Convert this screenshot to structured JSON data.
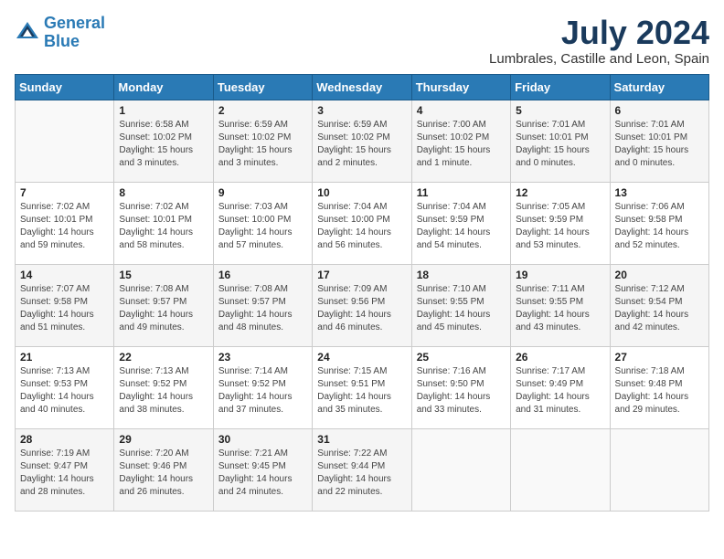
{
  "header": {
    "logo_line1": "General",
    "logo_line2": "Blue",
    "month_year": "July 2024",
    "location": "Lumbrales, Castille and Leon, Spain"
  },
  "weekdays": [
    "Sunday",
    "Monday",
    "Tuesday",
    "Wednesday",
    "Thursday",
    "Friday",
    "Saturday"
  ],
  "weeks": [
    [
      {
        "day": "",
        "content": ""
      },
      {
        "day": "1",
        "content": "Sunrise: 6:58 AM\nSunset: 10:02 PM\nDaylight: 15 hours\nand 3 minutes."
      },
      {
        "day": "2",
        "content": "Sunrise: 6:59 AM\nSunset: 10:02 PM\nDaylight: 15 hours\nand 3 minutes."
      },
      {
        "day": "3",
        "content": "Sunrise: 6:59 AM\nSunset: 10:02 PM\nDaylight: 15 hours\nand 2 minutes."
      },
      {
        "day": "4",
        "content": "Sunrise: 7:00 AM\nSunset: 10:02 PM\nDaylight: 15 hours\nand 1 minute."
      },
      {
        "day": "5",
        "content": "Sunrise: 7:01 AM\nSunset: 10:01 PM\nDaylight: 15 hours\nand 0 minutes."
      },
      {
        "day": "6",
        "content": "Sunrise: 7:01 AM\nSunset: 10:01 PM\nDaylight: 15 hours\nand 0 minutes."
      }
    ],
    [
      {
        "day": "7",
        "content": "Sunrise: 7:02 AM\nSunset: 10:01 PM\nDaylight: 14 hours\nand 59 minutes."
      },
      {
        "day": "8",
        "content": "Sunrise: 7:02 AM\nSunset: 10:01 PM\nDaylight: 14 hours\nand 58 minutes."
      },
      {
        "day": "9",
        "content": "Sunrise: 7:03 AM\nSunset: 10:00 PM\nDaylight: 14 hours\nand 57 minutes."
      },
      {
        "day": "10",
        "content": "Sunrise: 7:04 AM\nSunset: 10:00 PM\nDaylight: 14 hours\nand 56 minutes."
      },
      {
        "day": "11",
        "content": "Sunrise: 7:04 AM\nSunset: 9:59 PM\nDaylight: 14 hours\nand 54 minutes."
      },
      {
        "day": "12",
        "content": "Sunrise: 7:05 AM\nSunset: 9:59 PM\nDaylight: 14 hours\nand 53 minutes."
      },
      {
        "day": "13",
        "content": "Sunrise: 7:06 AM\nSunset: 9:58 PM\nDaylight: 14 hours\nand 52 minutes."
      }
    ],
    [
      {
        "day": "14",
        "content": "Sunrise: 7:07 AM\nSunset: 9:58 PM\nDaylight: 14 hours\nand 51 minutes."
      },
      {
        "day": "15",
        "content": "Sunrise: 7:08 AM\nSunset: 9:57 PM\nDaylight: 14 hours\nand 49 minutes."
      },
      {
        "day": "16",
        "content": "Sunrise: 7:08 AM\nSunset: 9:57 PM\nDaylight: 14 hours\nand 48 minutes."
      },
      {
        "day": "17",
        "content": "Sunrise: 7:09 AM\nSunset: 9:56 PM\nDaylight: 14 hours\nand 46 minutes."
      },
      {
        "day": "18",
        "content": "Sunrise: 7:10 AM\nSunset: 9:55 PM\nDaylight: 14 hours\nand 45 minutes."
      },
      {
        "day": "19",
        "content": "Sunrise: 7:11 AM\nSunset: 9:55 PM\nDaylight: 14 hours\nand 43 minutes."
      },
      {
        "day": "20",
        "content": "Sunrise: 7:12 AM\nSunset: 9:54 PM\nDaylight: 14 hours\nand 42 minutes."
      }
    ],
    [
      {
        "day": "21",
        "content": "Sunrise: 7:13 AM\nSunset: 9:53 PM\nDaylight: 14 hours\nand 40 minutes."
      },
      {
        "day": "22",
        "content": "Sunrise: 7:13 AM\nSunset: 9:52 PM\nDaylight: 14 hours\nand 38 minutes."
      },
      {
        "day": "23",
        "content": "Sunrise: 7:14 AM\nSunset: 9:52 PM\nDaylight: 14 hours\nand 37 minutes."
      },
      {
        "day": "24",
        "content": "Sunrise: 7:15 AM\nSunset: 9:51 PM\nDaylight: 14 hours\nand 35 minutes."
      },
      {
        "day": "25",
        "content": "Sunrise: 7:16 AM\nSunset: 9:50 PM\nDaylight: 14 hours\nand 33 minutes."
      },
      {
        "day": "26",
        "content": "Sunrise: 7:17 AM\nSunset: 9:49 PM\nDaylight: 14 hours\nand 31 minutes."
      },
      {
        "day": "27",
        "content": "Sunrise: 7:18 AM\nSunset: 9:48 PM\nDaylight: 14 hours\nand 29 minutes."
      }
    ],
    [
      {
        "day": "28",
        "content": "Sunrise: 7:19 AM\nSunset: 9:47 PM\nDaylight: 14 hours\nand 28 minutes."
      },
      {
        "day": "29",
        "content": "Sunrise: 7:20 AM\nSunset: 9:46 PM\nDaylight: 14 hours\nand 26 minutes."
      },
      {
        "day": "30",
        "content": "Sunrise: 7:21 AM\nSunset: 9:45 PM\nDaylight: 14 hours\nand 24 minutes."
      },
      {
        "day": "31",
        "content": "Sunrise: 7:22 AM\nSunset: 9:44 PM\nDaylight: 14 hours\nand 22 minutes."
      },
      {
        "day": "",
        "content": ""
      },
      {
        "day": "",
        "content": ""
      },
      {
        "day": "",
        "content": ""
      }
    ]
  ]
}
